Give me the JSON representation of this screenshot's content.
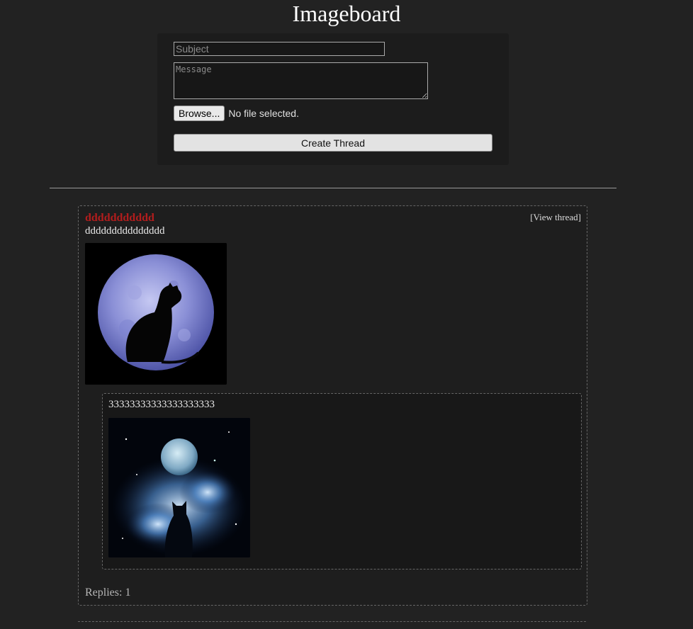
{
  "header": {
    "title": "Imageboard"
  },
  "form": {
    "subject_placeholder": "Subject",
    "message_placeholder": "Message",
    "browse_label": "Browse...",
    "file_status": "No file selected.",
    "submit_label": "Create Thread"
  },
  "threads": [
    {
      "subject": "ddddddddddd",
      "message": "ddddddddddddddd",
      "view_link": "[View thread]",
      "image_icon": "cat-moon-image",
      "replies": [
        {
          "message": "33333333333333333333",
          "image_icon": "cat-galaxy-image"
        }
      ],
      "replies_label": "Replies: 1"
    }
  ],
  "colors": {
    "background": "#222222",
    "panel": "#1c1c1c",
    "subject_red": "#b21d1d"
  }
}
